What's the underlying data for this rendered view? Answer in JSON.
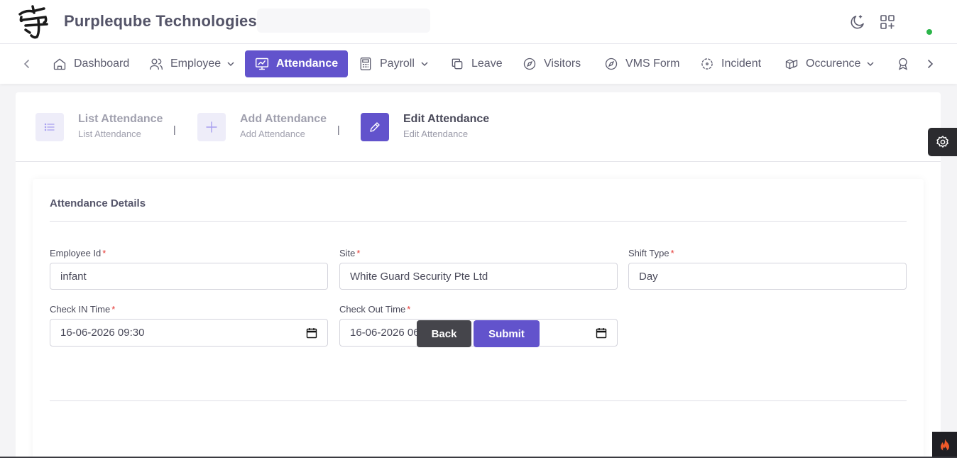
{
  "header": {
    "brand": "Purpleqube Technologies",
    "icons": [
      "moon-icon",
      "apps-add-icon"
    ]
  },
  "nav": {
    "items": [
      {
        "label": "Dashboard",
        "icon": "home-icon"
      },
      {
        "label": "Employee",
        "icon": "users-icon",
        "dropdown": true
      },
      {
        "label": "Attendance",
        "icon": "monitor-chart-icon",
        "active": true
      },
      {
        "label": "Payroll",
        "icon": "calculator-icon",
        "dropdown": true
      },
      {
        "label": "Leave",
        "icon": "copy-icon"
      },
      {
        "label": "Visitors",
        "icon": "compass-icon"
      },
      {
        "label": "VMS Form",
        "icon": "compass-icon"
      },
      {
        "label": "Incident",
        "icon": "focus-icon"
      },
      {
        "label": "Occurence",
        "icon": "boxes-icon",
        "dropdown": true
      }
    ]
  },
  "steps": [
    {
      "title": "List Attendance",
      "subtitle": "List Attendance",
      "icon": "list-icon"
    },
    {
      "title": "Add Attendance",
      "subtitle": "Add Attendance",
      "icon": "plus-icon"
    },
    {
      "title": "Edit Attendance",
      "subtitle": "Edit Attendance",
      "icon": "pencil-icon",
      "current": true
    }
  ],
  "step_separator": "|",
  "form": {
    "title": "Attendance Details",
    "required_marker": "*",
    "employee_id": {
      "label": "Employee Id",
      "value": "infant"
    },
    "site": {
      "label": "Site",
      "value": "White Guard Security Pte Ltd"
    },
    "shift_type": {
      "label": "Shift Type",
      "value": "Day"
    },
    "check_in": {
      "label": "Check IN Time",
      "value": "16-06-2026 09:30"
    },
    "check_out": {
      "label": "Check Out Time",
      "value": "16-06-2026 06:00"
    }
  },
  "buttons": {
    "back": "Back",
    "submit": "Submit"
  },
  "colors": {
    "accent": "#6253cc",
    "back_button": "#45454b",
    "required": "#e53935",
    "status_online": "#2bb54a"
  }
}
